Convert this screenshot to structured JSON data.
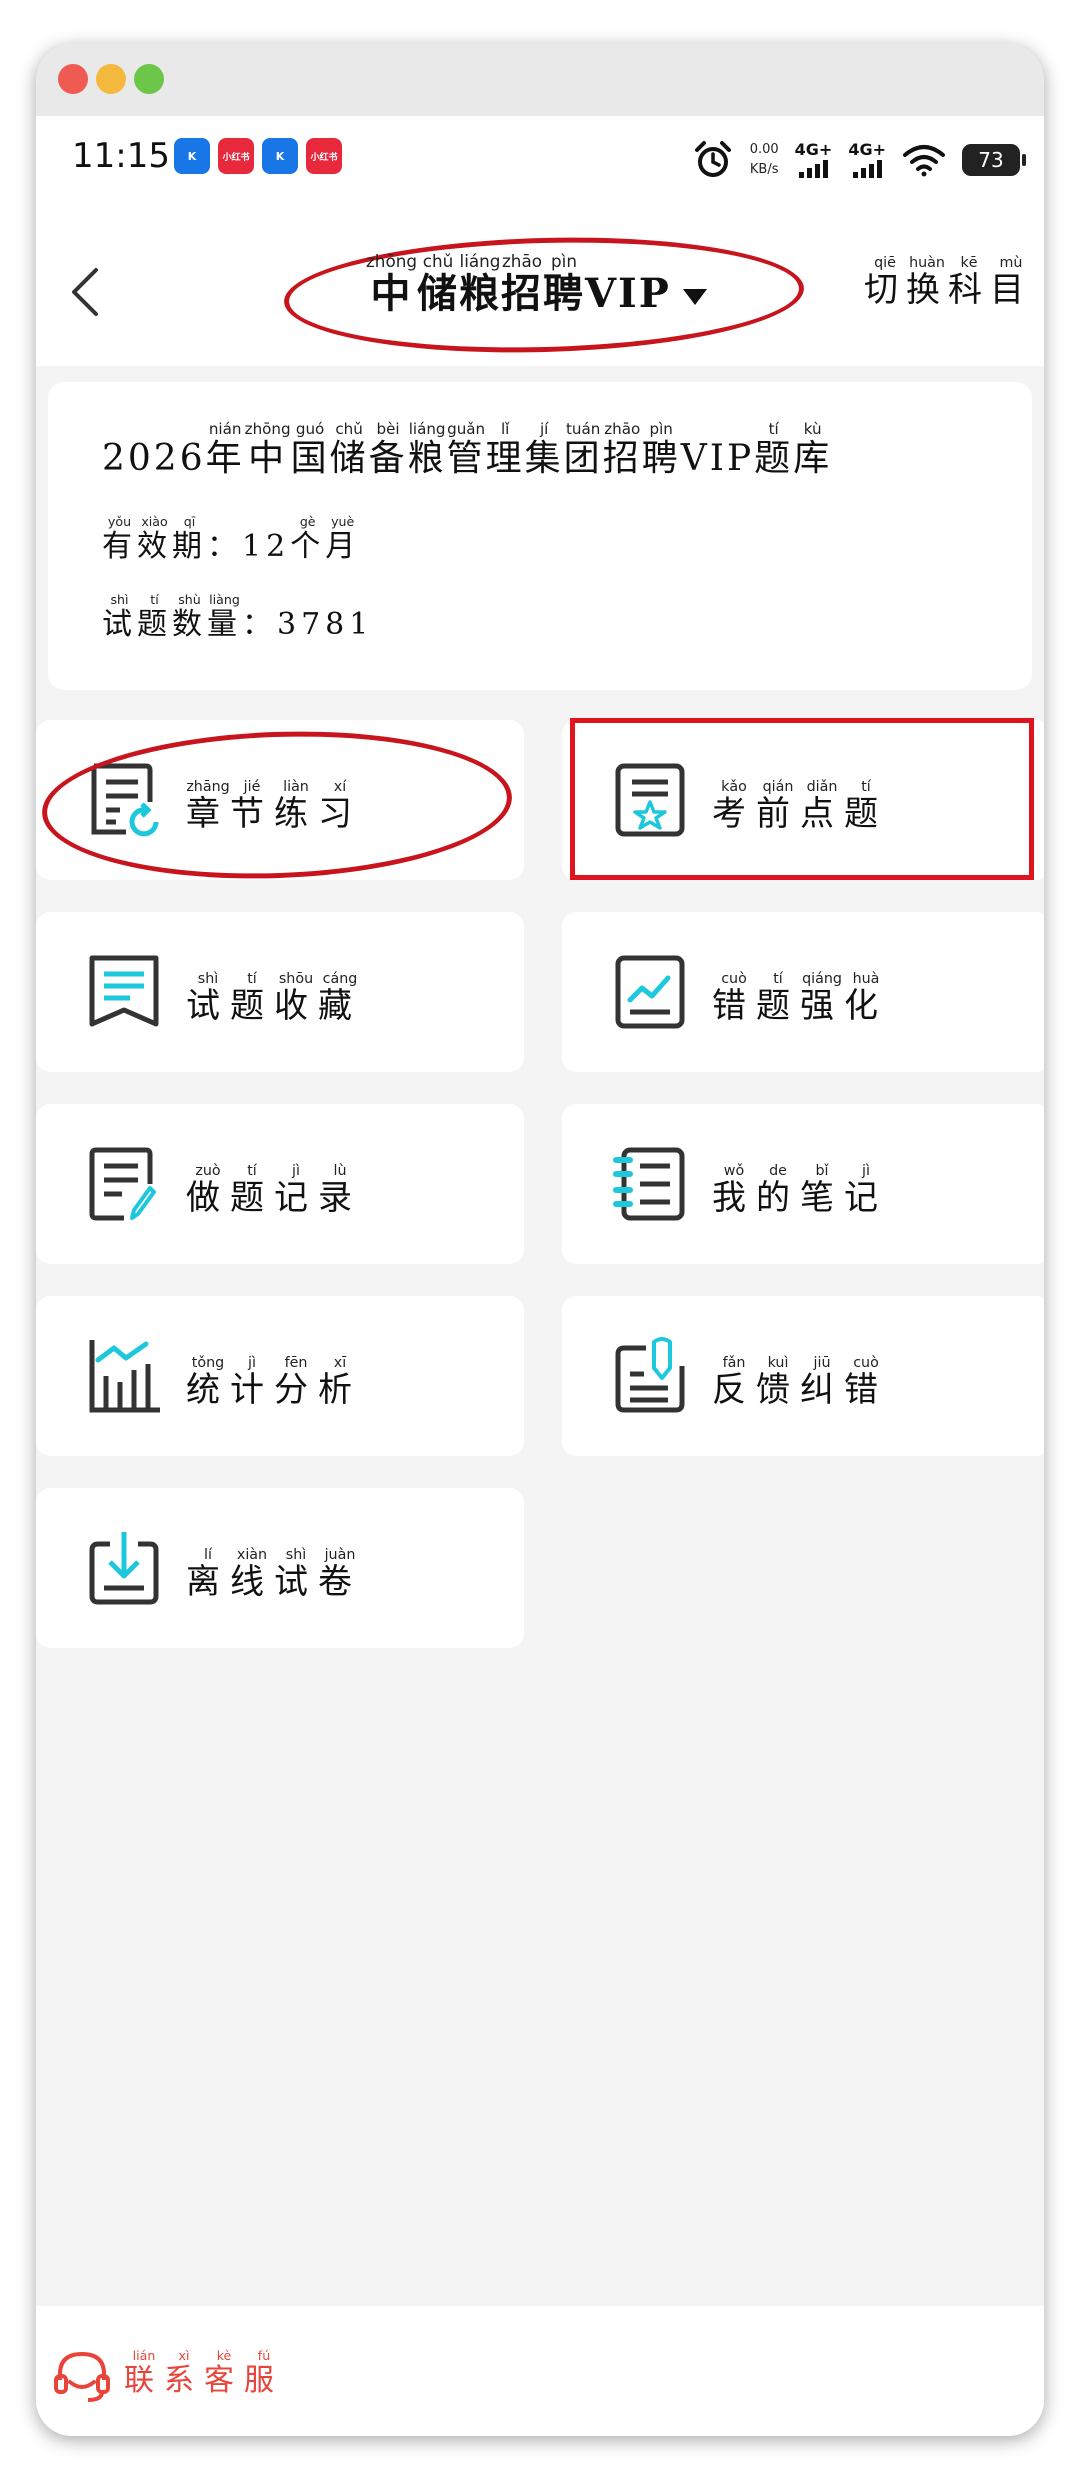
{
  "status": {
    "time": "11:15",
    "apps": [
      "K",
      "小红书",
      "K",
      "小红书"
    ],
    "net_speed_value": "0.00",
    "net_speed_unit": "KB/s",
    "signal1": "4G+",
    "signal2": "4G+",
    "battery": "73"
  },
  "nav": {
    "title_chars": [
      "中",
      "储",
      "粮",
      "招",
      "聘"
    ],
    "title_pinyin": [
      "zhōng",
      "chǔ",
      "liáng",
      "zhāo",
      "pìn"
    ],
    "title_suffix": "VIP",
    "switch_chars": [
      "切",
      "换",
      "科",
      "目"
    ],
    "switch_pinyin": [
      "qiē",
      "huàn",
      "kē",
      "mù"
    ]
  },
  "info": {
    "title_prefix": "2026",
    "title_chars": [
      "年",
      "中",
      "国",
      "储",
      "备",
      "粮",
      "管",
      "理",
      "集",
      "团",
      "招",
      "聘"
    ],
    "title_pinyin": [
      "nián",
      "zhōng",
      "guó",
      "chǔ",
      "bèi",
      "liáng",
      "guǎn",
      "lǐ",
      "jí",
      "tuán",
      "zhāo",
      "pìn"
    ],
    "title_mid": "VIP",
    "title_end_chars": [
      "题",
      "库"
    ],
    "title_end_pinyin": [
      "tí",
      "kù"
    ],
    "validity_chars": [
      "有",
      "效",
      "期"
    ],
    "validity_pinyin": [
      "yǒu",
      "xiào",
      "qī"
    ],
    "validity_num": "12",
    "validity_unit_chars": [
      "个",
      "月"
    ],
    "validity_unit_pinyin": [
      "gè",
      "yuè"
    ],
    "count_chars": [
      "试",
      "题",
      "数",
      "量"
    ],
    "count_pinyin": [
      "shì",
      "tí",
      "shù",
      "liàng"
    ],
    "count_value": "3781"
  },
  "menu": [
    {
      "chars": [
        "章",
        "节",
        "练",
        "习"
      ],
      "pinyin": [
        "zhāng",
        "jié",
        "liàn",
        "xí"
      ],
      "icon": "chapter-practice-icon"
    },
    {
      "chars": [
        "考",
        "前",
        "点",
        "题"
      ],
      "pinyin": [
        "kǎo",
        "qián",
        "diǎn",
        "tí"
      ],
      "icon": "exam-tips-icon"
    },
    {
      "chars": [
        "试",
        "题",
        "收",
        "藏"
      ],
      "pinyin": [
        "shì",
        "tí",
        "shōu",
        "cáng"
      ],
      "icon": "bookmark-icon"
    },
    {
      "chars": [
        "错",
        "题",
        "强",
        "化"
      ],
      "pinyin": [
        "cuò",
        "tí",
        "qiáng",
        "huà"
      ],
      "icon": "trend-icon"
    },
    {
      "chars": [
        "做",
        "题",
        "记",
        "录"
      ],
      "pinyin": [
        "zuò",
        "tí",
        "jì",
        "lù"
      ],
      "icon": "edit-record-icon"
    },
    {
      "chars": [
        "我",
        "的",
        "笔",
        "记"
      ],
      "pinyin": [
        "wǒ",
        "de",
        "bǐ",
        "jì"
      ],
      "icon": "notebook-icon"
    },
    {
      "chars": [
        "统",
        "计",
        "分",
        "析"
      ],
      "pinyin": [
        "tǒng",
        "jì",
        "fēn",
        "xī"
      ],
      "icon": "bar-chart-icon"
    },
    {
      "chars": [
        "反",
        "馈",
        "纠",
        "错"
      ],
      "pinyin": [
        "fǎn",
        "kuì",
        "jiū",
        "cuò"
      ],
      "icon": "feedback-icon"
    },
    {
      "chars": [
        "离",
        "线",
        "试",
        "卷"
      ],
      "pinyin": [
        "lí",
        "xiàn",
        "shì",
        "juàn"
      ],
      "icon": "download-icon"
    }
  ],
  "footer": {
    "chars": [
      "联",
      "系",
      "客",
      "服"
    ],
    "pinyin": [
      "lián",
      "xì",
      "kè",
      "fú"
    ],
    "icon": "headset-icon"
  },
  "colors": {
    "accent": "#1ec8dc",
    "annotation_red": "#d8141c",
    "service_red": "#e8443a"
  }
}
